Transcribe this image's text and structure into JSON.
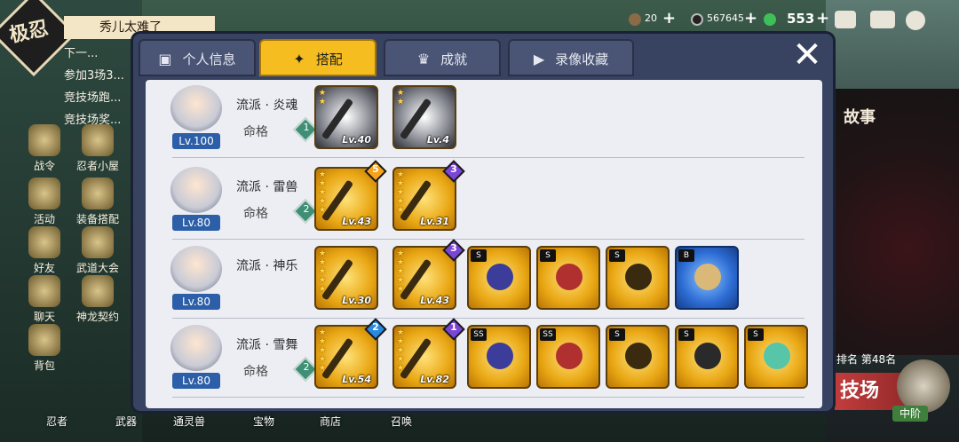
{
  "background": {
    "emblem_text": "极忍",
    "task_title": "秀儿太难了",
    "task_items": [
      "下一...",
      "参加3场3...",
      "竞技场跑...",
      "竞技场奖..."
    ],
    "story_label": "故事",
    "left_menu": [
      "战令",
      "忍者小屋",
      "活动",
      "装备搭配",
      "好友",
      "武道大会",
      "聊天",
      "神龙契约",
      "背包"
    ],
    "bottom_bar": [
      "忍者",
      "武器",
      "通灵兽",
      "宝物",
      "商店",
      "召唤"
    ],
    "rank_label": "排名 第48名",
    "arena_label": "技场",
    "stage_badge": "中阶"
  },
  "topbar": {
    "coins": "20",
    "tokens": "567645",
    "stamina": "553"
  },
  "modal": {
    "tabs": [
      {
        "label": "个人信息",
        "icon": "person-card-icon",
        "active": false
      },
      {
        "label": "搭配",
        "icon": "shuriken-icon",
        "active": true
      },
      {
        "label": "成就",
        "icon": "trophy-icon",
        "active": false
      },
      {
        "label": "录像收藏",
        "icon": "play-icon",
        "active": false
      }
    ],
    "close_symbol": "✕"
  },
  "rows": [
    {
      "level": "Lv.100",
      "faction": "流派 · 炎魂",
      "fate_label": "命格",
      "fate_value": "1",
      "items": [
        {
          "type": "silver",
          "level": "Lv.40",
          "stars": "★\n★"
        },
        {
          "type": "silver",
          "level": "Lv.4",
          "stars": "★\n★"
        }
      ]
    },
    {
      "level": "Lv.80",
      "faction": "流派 · 雷兽",
      "fate_label": "命格",
      "fate_value": "2",
      "items": [
        {
          "type": "gold",
          "level": "Lv.43",
          "stars": "★\n★\n★\n★\n★",
          "rank": "5",
          "rank_color": "#f6a21a"
        },
        {
          "type": "gold",
          "level": "Lv.31",
          "stars": "★\n★\n★\n★\n★",
          "rank": "3",
          "rank_color": "#7b45d6"
        }
      ]
    },
    {
      "level": "Lv.80",
      "faction": "流派 · 神乐",
      "fate_label": "",
      "fate_value": "",
      "items": [
        {
          "type": "gold",
          "level": "Lv.30",
          "stars": "★\n★\n★\n★\n★"
        },
        {
          "type": "gold",
          "level": "Lv.43",
          "stars": "★\n★\n★\n★\n★",
          "rank": "3",
          "rank_color": "#7b45d6"
        },
        {
          "type": "gold",
          "level": "",
          "grade": "S"
        },
        {
          "type": "gold",
          "level": "",
          "grade": "S"
        },
        {
          "type": "gold",
          "level": "",
          "grade": "S"
        },
        {
          "type": "blue",
          "level": "",
          "grade": "B"
        }
      ]
    },
    {
      "level": "Lv.80",
      "faction": "流派 · 雪舞",
      "fate_label": "命格",
      "fate_value": "2",
      "items": [
        {
          "type": "gold",
          "level": "Lv.54",
          "stars": "★\n★\n★\n★\n★",
          "rank": "2",
          "rank_color": "#2a8ae0"
        },
        {
          "type": "gold",
          "level": "Lv.82",
          "stars": "★\n★\n★\n★\n★",
          "rank": "1",
          "rank_color": "#7b45d6"
        },
        {
          "type": "gold",
          "level": "",
          "grade": "SS"
        },
        {
          "type": "gold",
          "level": "",
          "grade": "SS"
        },
        {
          "type": "gold",
          "level": "",
          "grade": "S"
        },
        {
          "type": "gold",
          "level": "",
          "grade": "S"
        },
        {
          "type": "gold",
          "level": "",
          "grade": "S"
        }
      ]
    }
  ]
}
